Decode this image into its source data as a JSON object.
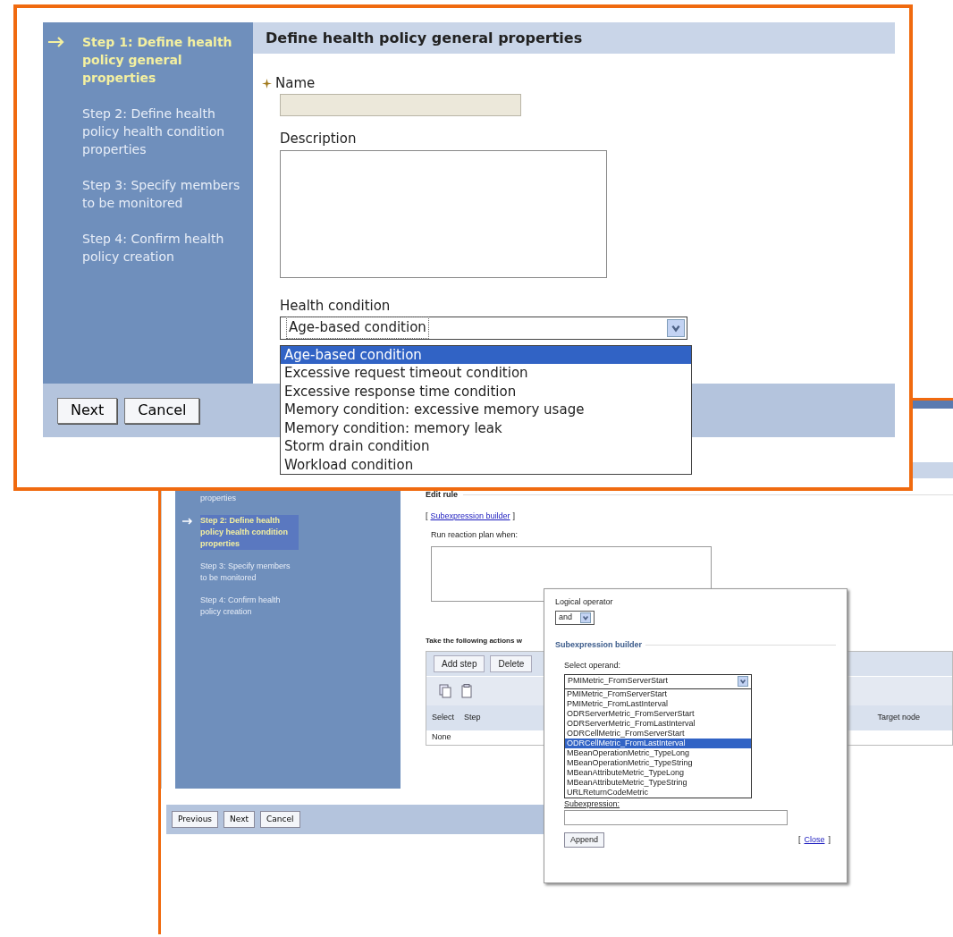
{
  "front_panel": {
    "steps": [
      {
        "label": "Step 1: Define health policy general properties",
        "selected": true
      },
      {
        "label": "Step 2: Define health policy health condition properties",
        "selected": false
      },
      {
        "label": "Step 3: Specify members to be monitored",
        "selected": false
      },
      {
        "label": "Step 4: Confirm health policy creation",
        "selected": false
      }
    ],
    "title": "Define health policy general properties",
    "name_label": "Name",
    "description_label": "Description",
    "health_condition_label": "Health condition",
    "health_condition_value": "Age-based condition",
    "options": [
      {
        "label": "Age-based condition",
        "selected": true
      },
      {
        "label": "Excessive request timeout condition",
        "selected": false
      },
      {
        "label": "Excessive response time condition",
        "selected": false
      },
      {
        "label": "Memory condition: excessive memory usage",
        "selected": false
      },
      {
        "label": "Memory condition: memory leak",
        "selected": false
      },
      {
        "label": "Storm drain condition",
        "selected": false
      },
      {
        "label": "Workload condition",
        "selected": false
      }
    ],
    "buttons": [
      "Next",
      "Cancel"
    ]
  },
  "back_panel": {
    "steps": [
      {
        "label": "properties",
        "selected": false
      },
      {
        "label": "Step 2: Define health policy health condition properties",
        "selected": true
      },
      {
        "label": "Step 3: Specify members to be monitored",
        "selected": false
      },
      {
        "label": "Step 4: Confirm health policy creation",
        "selected": false
      }
    ],
    "edit_rule_legend": "Edit rule",
    "link_brackets": [
      "[",
      "]"
    ],
    "subexpression_link": "Subexpression builder",
    "run_when_label": "Run reaction plan when:",
    "actions_label": "Take the following actions w",
    "toolbar_buttons": [
      "Add step",
      "Delete"
    ],
    "columns": [
      "Select",
      "Step",
      "Target node"
    ],
    "empty_row": "None",
    "footer_buttons": [
      "Previous",
      "Next",
      "Cancel"
    ]
  },
  "popup": {
    "logical_operator_label": "Logical operator",
    "logical_operator_value": "and",
    "legend": "Subexpression builder",
    "operand_label": "Select operand:",
    "operand_value": "PMIMetric_FromServerStart",
    "options": [
      {
        "label": "PMIMetric_FromServerStart",
        "selected": false
      },
      {
        "label": "PMIMetric_FromLastInterval",
        "selected": false
      },
      {
        "label": "ODRServerMetric_FromServerStart",
        "selected": false
      },
      {
        "label": "ODRServerMetric_FromLastInterval",
        "selected": false
      },
      {
        "label": "ODRCellMetric_FromServerStart",
        "selected": false
      },
      {
        "label": "ODRCellMetric_FromLastInterval",
        "selected": true
      },
      {
        "label": "MBeanOperationMetric_TypeLong",
        "selected": false
      },
      {
        "label": "MBeanOperationMetric_TypeString",
        "selected": false
      },
      {
        "label": "MBeanAttributeMetric_TypeLong",
        "selected": false
      },
      {
        "label": "MBeanAttributeMetric_TypeString",
        "selected": false
      },
      {
        "label": "URLReturnCodeMetric",
        "selected": false
      }
    ],
    "subexpression_label": "Subexpression:",
    "append_button": "Append",
    "close_link": "Close"
  }
}
